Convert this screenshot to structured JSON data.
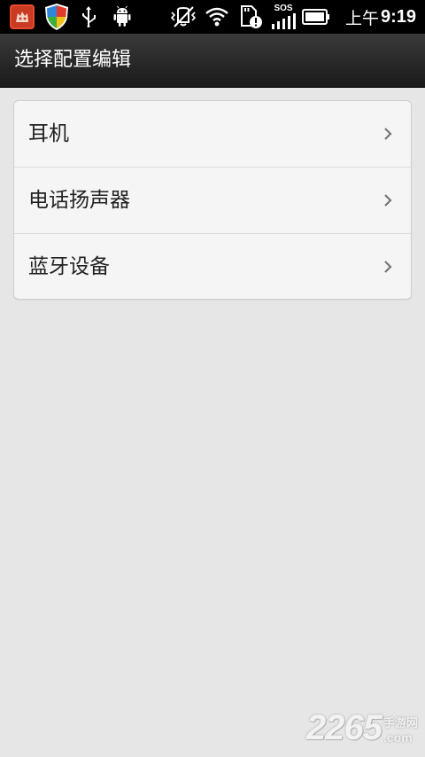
{
  "status_bar": {
    "time_period": "上午",
    "time": "9:19",
    "sos_label": "SOS",
    "icons": [
      "app-icon",
      "shield-icon",
      "usb-icon",
      "android-debug-icon",
      "vibrate-off-icon",
      "wifi-icon",
      "sd-card-alert-icon",
      "signal-icon",
      "battery-icon"
    ]
  },
  "title_bar": {
    "title": "选择配置编辑"
  },
  "list": {
    "items": [
      {
        "label": "耳机"
      },
      {
        "label": "电话扬声器"
      },
      {
        "label": "蓝牙设备"
      }
    ]
  },
  "watermark": {
    "number": "2265",
    "cn_text": "手游网",
    "com_text": ".com"
  }
}
